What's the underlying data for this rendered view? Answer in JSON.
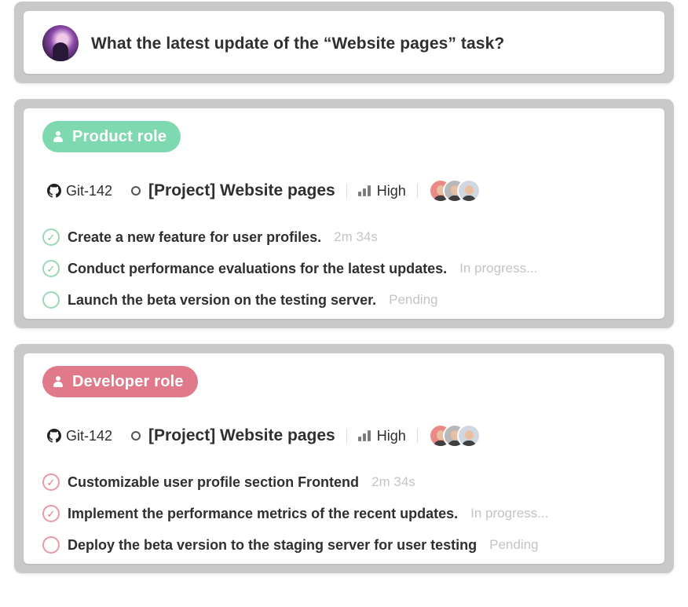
{
  "question": {
    "text": "What the latest update of the “Website pages” task?",
    "avatar": "user-avatar"
  },
  "sections": [
    {
      "role_label": "Product role",
      "accent": "#7ed9b0",
      "git_id": "Git-142",
      "project": "[Project] Website pages",
      "priority": "High",
      "tasks": [
        {
          "text": "Create a new feature for user profiles.",
          "status": "2m 34s",
          "state": "done"
        },
        {
          "text": "Conduct performance evaluations for the latest updates.",
          "status": "In progress...",
          "state": "in-progress"
        },
        {
          "text": "Launch the beta version on the testing server.",
          "status": "Pending",
          "state": "pending"
        }
      ]
    },
    {
      "role_label": "Developer role",
      "accent": "#e07a8a",
      "git_id": "Git-142",
      "project": "[Project] Website pages",
      "priority": "High",
      "tasks": [
        {
          "text": "Customizable user profile section Frontend",
          "status": "2m 34s",
          "state": "done"
        },
        {
          "text": "Implement the performance metrics of the recent updates.",
          "status": "In progress...",
          "state": "in-progress"
        },
        {
          "text": "Deploy the beta version to the staging server for user testing",
          "status": "Pending",
          "state": "pending"
        }
      ]
    }
  ],
  "icons": {
    "github": "github-icon",
    "project": "circle-icon",
    "priority": "signal-bars-icon",
    "role": "person-icon",
    "task_done": "check-circle-icon",
    "task_pending": "empty-circle-icon"
  }
}
